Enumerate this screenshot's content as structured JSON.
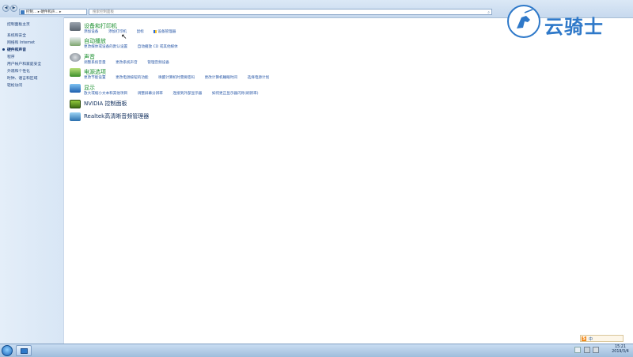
{
  "window": {
    "nav_back": "◀",
    "nav_forward": "▶",
    "address_path": "控制... ▸ 硬件和声... ▸",
    "search_placeholder": "搜索控制面板"
  },
  "sidebar": {
    "home": "控制面板主页",
    "items": [
      {
        "label": "系统和安全"
      },
      {
        "label": "网络和 Internet"
      },
      {
        "label": "硬件和声音"
      },
      {
        "label": "程序"
      },
      {
        "label": "用户帐户和家庭安全"
      },
      {
        "label": "外观和个性化"
      },
      {
        "label": "时钟、语言和区域"
      },
      {
        "label": "轻松访问"
      }
    ],
    "active_index": 2
  },
  "categories": [
    {
      "title": "设备和打印机",
      "icon": "devices-printers-icon",
      "links": [
        "添加设备",
        "添加打印机",
        "鼠标",
        "设备管理器"
      ]
    },
    {
      "title": "自动播放",
      "icon": "autoplay-icon",
      "links": [
        "更改媒体或设备的默认设置",
        "自动播放 CD 或其他媒体"
      ]
    },
    {
      "title": "声音",
      "icon": "sound-icon",
      "links": [
        "调整系统音量",
        "更改系统声音",
        "管理音频设备"
      ]
    },
    {
      "title": "电源选项",
      "icon": "power-options-icon",
      "links": [
        "更改节能设置",
        "更改电源按钮的功能",
        "唤醒计算机时需要密码",
        "更改计算机睡眠时间",
        "选择电源计划"
      ]
    },
    {
      "title": "显示",
      "icon": "display-icon",
      "links": [
        "放大或缩小文本和其他项目",
        "调整屏幕分辨率",
        "连接到外部显示器",
        "如何更正显示器闪烁(刷新率)"
      ]
    },
    {
      "title": "NVIDIA 控制面板",
      "icon": "nvidia-icon",
      "links": []
    },
    {
      "title": "Realtek高清晰音频管理器",
      "icon": "realtek-audio-icon",
      "links": []
    }
  ],
  "watermark": {
    "text": "云骑士"
  },
  "taskbar": {
    "ime_label": "中",
    "clock_time": "15:21",
    "clock_date": "2019/3/4"
  },
  "colors": {
    "category_title": "#1a8f2e",
    "link": "#2a59a8",
    "sidebar_bg": "#dde9f7",
    "watermark": "#2f79c9"
  }
}
